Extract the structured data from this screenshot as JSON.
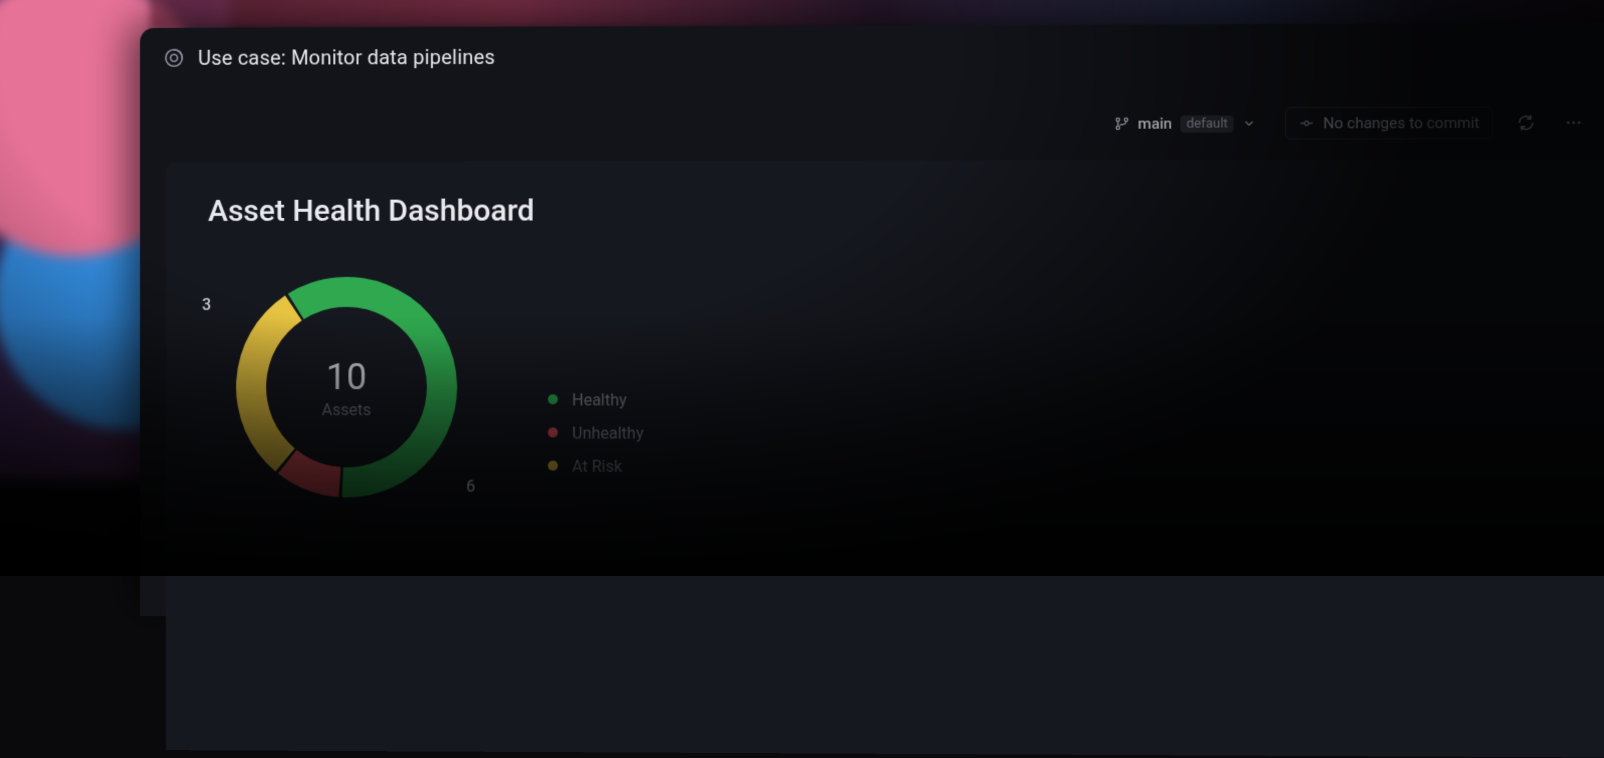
{
  "window": {
    "title": "Use case: Monitor data pipelines"
  },
  "toolbar": {
    "branch": {
      "name": "main",
      "default_badge": "default"
    },
    "commit_status": "No changes to commit"
  },
  "dashboard": {
    "title": "Asset Health Dashboard",
    "donut": {
      "count": "10",
      "label": "Assets",
      "outer_labels": {
        "top_left": "3",
        "bottom_right": "6"
      }
    },
    "legend": [
      {
        "label": "Healthy",
        "color": "#2fa84f"
      },
      {
        "label": "Unhealthy",
        "color": "#d9505b"
      },
      {
        "label": "At Risk",
        "color": "#e6c341"
      }
    ]
  },
  "chart_data": {
    "type": "pie",
    "title": "Asset Health Dashboard",
    "total_label": "Assets",
    "total": 10,
    "series": [
      {
        "name": "Healthy",
        "value": 6,
        "color": "#2fa84f"
      },
      {
        "name": "At Risk",
        "value": 3,
        "color": "#e6c341"
      },
      {
        "name": "Unhealthy",
        "value": 1,
        "color": "#d9505b"
      }
    ]
  }
}
